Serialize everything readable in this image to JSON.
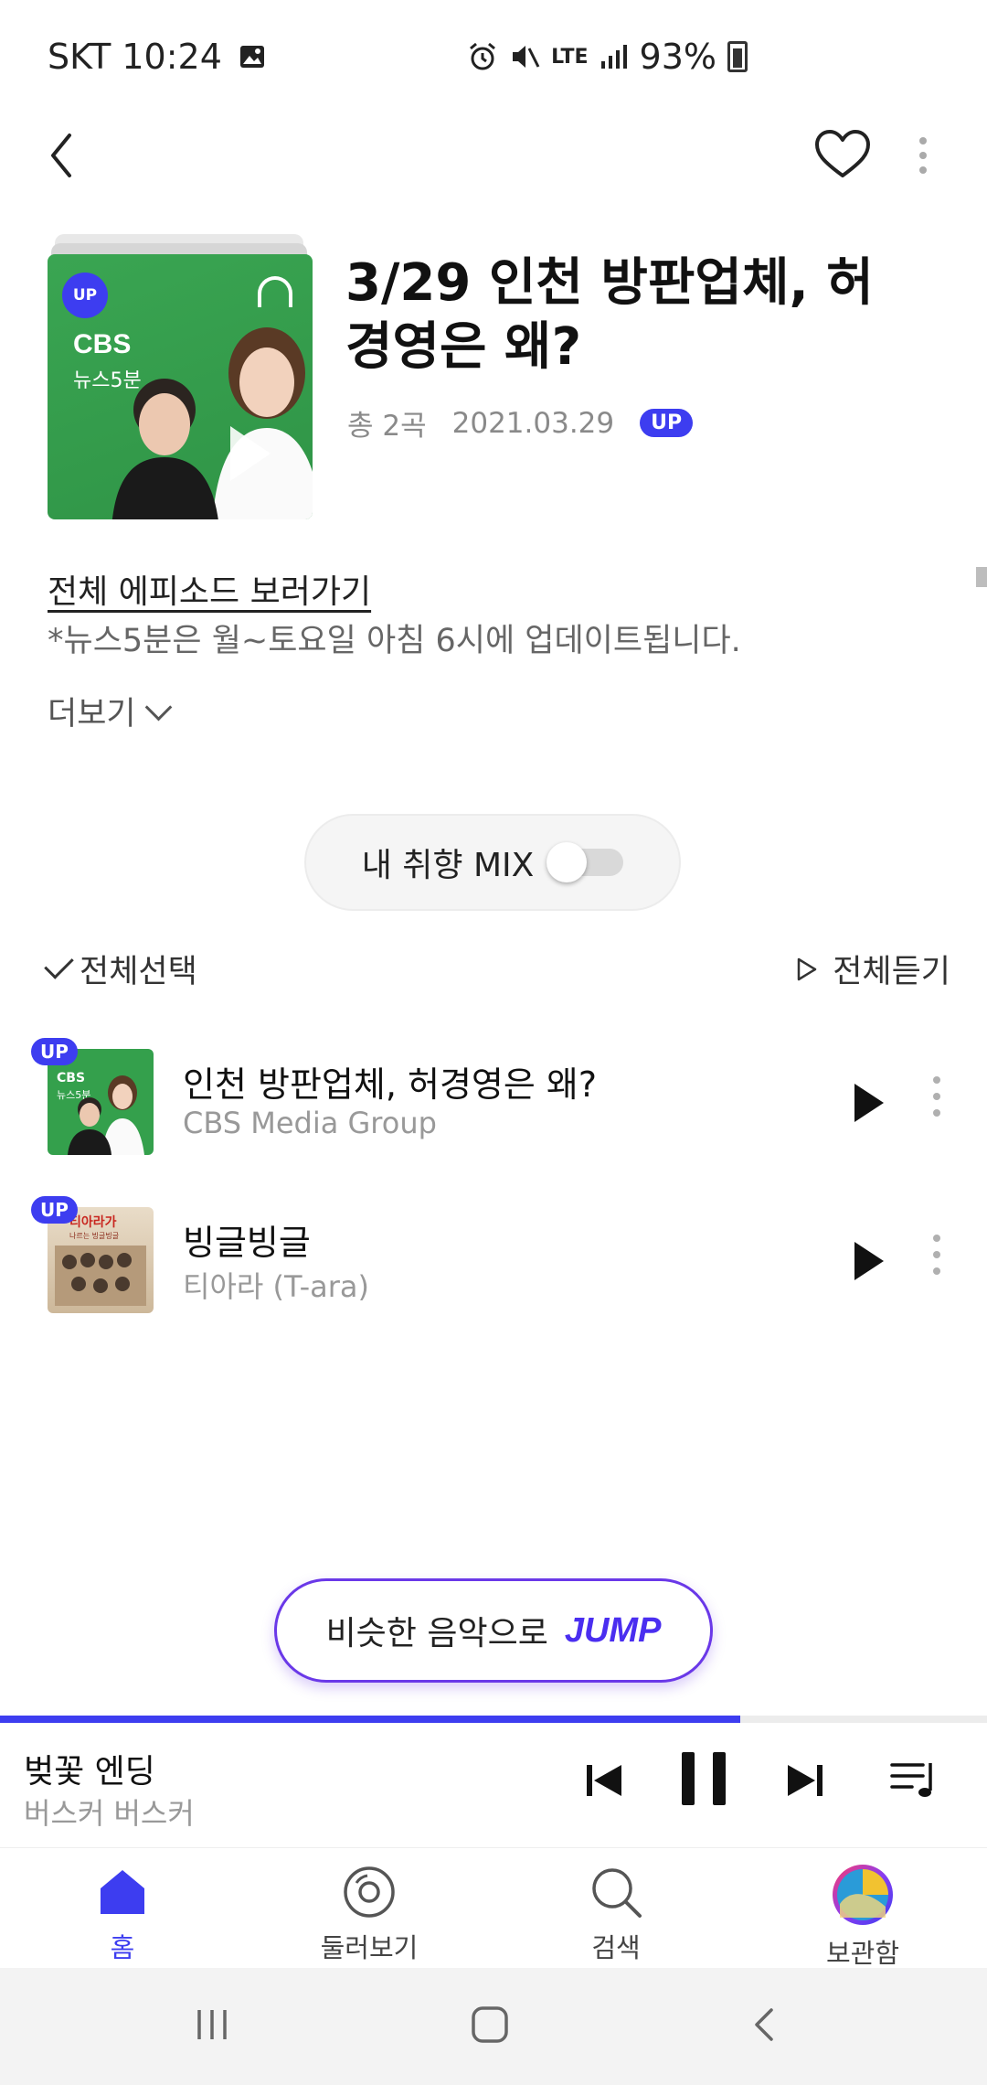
{
  "status_bar": {
    "carrier_time": "SKT 10:24",
    "network": "LTE",
    "battery": "93%",
    "icons": [
      "image-icon",
      "alarm-icon",
      "mute-icon",
      "lte-icon",
      "signal-icon",
      "battery-icon"
    ]
  },
  "header": {
    "back_icon": "back-arrow-icon",
    "like_icon": "heart-icon",
    "more_icon": "more-vertical-icon"
  },
  "album": {
    "badge": "UP",
    "brand": "CBS",
    "show_name": "뉴스5분",
    "title": "3/29 인천 방판업체, 허경영은 왜?",
    "track_count": "총 2곡",
    "date": "2021.03.29",
    "up_label": "UP"
  },
  "info": {
    "episodes_link": "전체 에피소드 보러가기",
    "description": "*뉴스5분은 월~토요일 아침 6시에 업데이트됩니다.",
    "more": "더보기"
  },
  "mix": {
    "label": "내 취향 MIX",
    "enabled": false
  },
  "list_controls": {
    "select_all": "전체선택",
    "play_all": "전체듣기"
  },
  "tracks": [
    {
      "badge": "UP",
      "title": "인천 방판업체, 허경영은 왜?",
      "artist": "CBS Media Group",
      "thumb_brand": "CBS",
      "thumb_show": "뉴스5분"
    },
    {
      "badge": "UP",
      "title": "빙글빙글",
      "artist": "티아라 (T-ara)",
      "thumb_text": "티아라가",
      "thumb_sub": "나르는 빙글빙글"
    }
  ],
  "jump": {
    "text": "비슷한 음악으로",
    "word": "JUMP"
  },
  "now_playing": {
    "title": "벚꽃 엔딩",
    "artist": "버스커 버스커",
    "progress_fraction": 0.75
  },
  "bottom_nav": {
    "items": [
      {
        "label": "홈",
        "icon": "home-icon",
        "active": true
      },
      {
        "label": "둘러보기",
        "icon": "disc-icon",
        "active": false
      },
      {
        "label": "검색",
        "icon": "search-icon",
        "active": false
      },
      {
        "label": "보관함",
        "icon": "library-avatar-icon",
        "active": false
      }
    ]
  },
  "colors": {
    "accent": "#3d3df0",
    "album_green": "#34a04c",
    "jump_border": "#6a38e8"
  }
}
